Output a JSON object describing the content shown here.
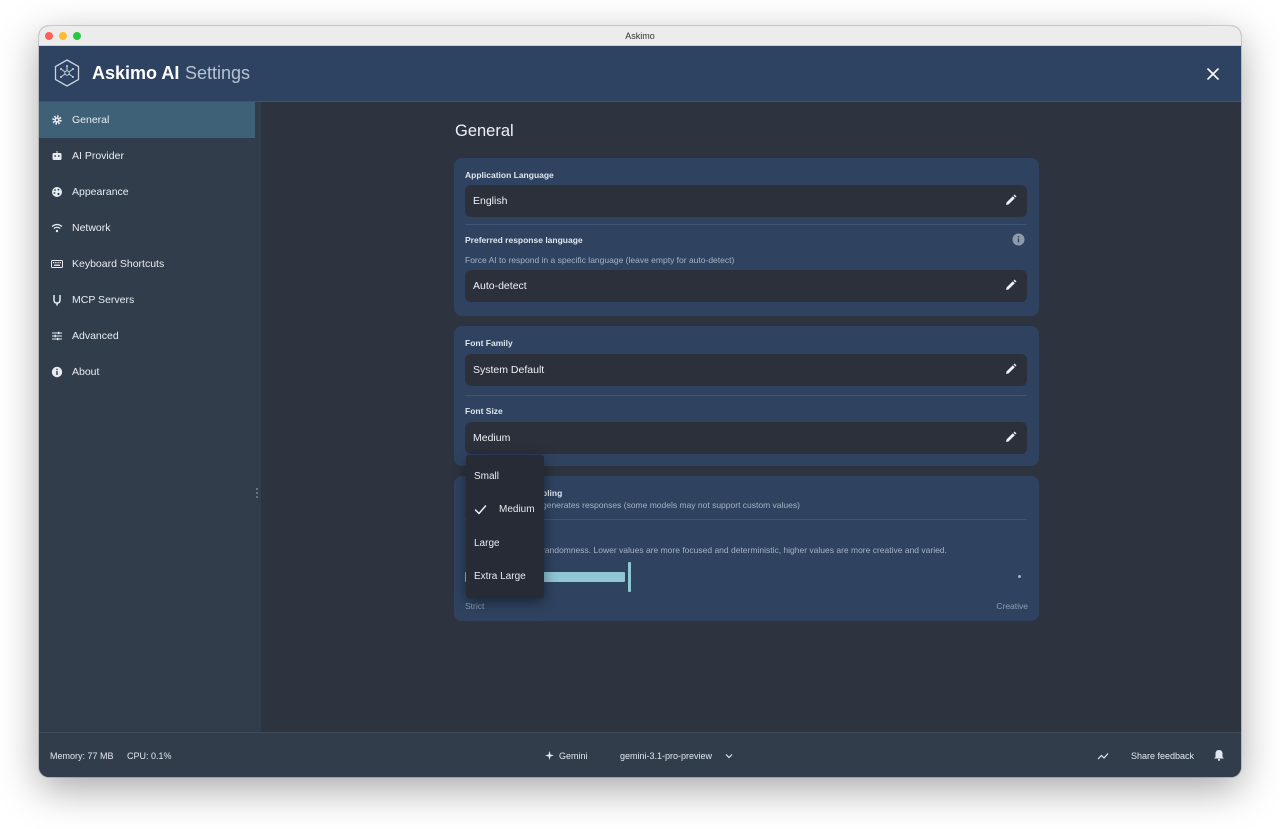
{
  "window": {
    "title": "Askimo"
  },
  "header": {
    "brand": "Askimo AI",
    "section": "Settings"
  },
  "sidebar": {
    "items": [
      {
        "label": "General",
        "icon": "gear-icon",
        "active": true
      },
      {
        "label": "AI Provider",
        "icon": "robot-icon",
        "active": false
      },
      {
        "label": "Appearance",
        "icon": "palette-icon",
        "active": false
      },
      {
        "label": "Network",
        "icon": "wifi-icon",
        "active": false
      },
      {
        "label": "Keyboard Shortcuts",
        "icon": "keyboard-icon",
        "active": false
      },
      {
        "label": "MCP Servers",
        "icon": "plug-icon",
        "active": false
      },
      {
        "label": "Advanced",
        "icon": "sliders-icon",
        "active": false
      },
      {
        "label": "About",
        "icon": "info-icon",
        "active": false
      }
    ]
  },
  "main": {
    "title": "General",
    "language_card": {
      "app_language_label": "Application Language",
      "app_language_value": "English",
      "response_language_label": "Preferred response language",
      "response_language_desc": "Force AI to respond in a specific language (leave empty for auto-detect)",
      "response_language_value": "Auto-detect"
    },
    "font_card": {
      "font_family_label": "Font Family",
      "font_family_value": "System Default",
      "font_size_label": "Font Size",
      "font_size_value": "Medium"
    },
    "sampling_card": {
      "title_partial": "pling",
      "desc_partial": "generates responses (some models may not support custom values)",
      "temperature_desc_partial": "randomness. Lower values are more focused and deterministic, higher values are more creative and varied.",
      "slider_min_label": "Strict",
      "slider_max_label": "Creative",
      "slider_value_fraction": 0.29
    }
  },
  "dropdown": {
    "options": [
      "Small",
      "Medium",
      "Large",
      "Extra Large"
    ],
    "selected": "Medium"
  },
  "statusbar": {
    "memory": "Memory: 77 MB",
    "cpu": "CPU: 0.1%",
    "provider": "Gemini",
    "model": "gemini-3.1-pro-preview",
    "feedback": "Share feedback"
  },
  "colors": {
    "header_bg": "#2d4361",
    "sidebar_bg": "#323d4c",
    "sidebar_active": "#3f6177",
    "card_bg": "#2f4361",
    "field_bg": "#2b303b",
    "accent_slider": "#8fc6d4"
  }
}
